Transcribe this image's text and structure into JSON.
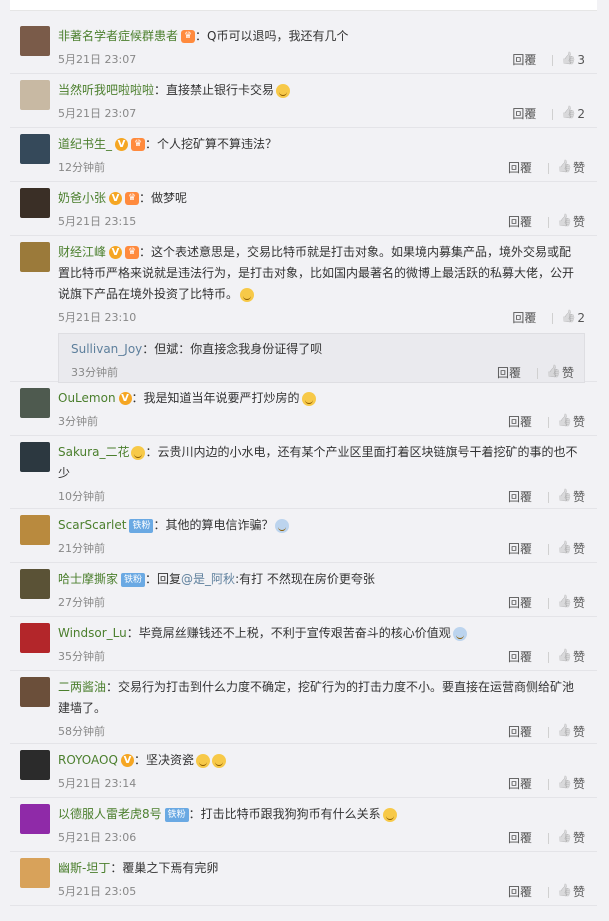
{
  "reply_label": "回覆",
  "comments": [
    {
      "user": "非著名学者症候群患者",
      "text": "：Q币可以退吗，我还有几个",
      "time": "5月21日 23:07",
      "likes": "3",
      "badges": [
        "crown"
      ],
      "avatar_color": "#7a5b49"
    },
    {
      "user": "当然听我吧啦啦啦",
      "text": "：直接禁止银行卡交易",
      "time": "5月21日 23:07",
      "likes": "2",
      "badges": [],
      "emoji": true,
      "avatar_color": "#c8b9a3"
    },
    {
      "user": "道纪书生_",
      "text": "：个人挖矿算不算违法？",
      "time": "12分钟前",
      "likes": "赞",
      "badges": [
        "v",
        "crown"
      ],
      "avatar_color": "#35495a"
    },
    {
      "user": "奶爸小张",
      "text": "：做梦呢",
      "time": "5月21日 23:15",
      "likes": "赞",
      "badges": [
        "v",
        "crown"
      ],
      "avatar_color": "#3a2f26"
    },
    {
      "user": "财经江峰",
      "text_lines": [
        "：这个表述意思是，交易比特币就是打击对象。如果境内募集产品，境外交易或配",
        "置比特币严格来说就是违法行为，是打击对象，比如国内最著名的微博上最活跃的私募大佬，公开",
        "说旗下产品在境外投资了比特币。"
      ],
      "time": "5月21日 23:10",
      "likes": "2",
      "badges": [
        "v",
        "crown"
      ],
      "avatar_color": "#9b7a3a",
      "subreply": {
        "user": "Sullivan_Joy",
        "text": "：但斌：你直接念我身份证得了呗",
        "time": "33分钟前",
        "likes": "赞"
      }
    },
    {
      "user": "OuLemon",
      "text": "：我是知道当年说要严打炒房的",
      "time": "3分钟前",
      "likes": "赞",
      "badges": [
        "v"
      ],
      "emoji": true,
      "avatar_color": "#4e5a4f"
    },
    {
      "user": "Sakura_二花",
      "text_lines": [
        "：云贵川内边的小水电，还有某个产业区里面打着区块链旗号干着挖矿的事的也不",
        "少"
      ],
      "time": "10分钟前",
      "likes": "赞",
      "badges": [],
      "lead_emoji": true,
      "avatar_color": "#2c3840"
    },
    {
      "user": "ScarScarlet",
      "text": "：其他的算电信诈骗？",
      "time": "21分钟前",
      "likes": "赞",
      "badges": [
        "iron"
      ],
      "emoji": true,
      "emoji_type": "cry",
      "avatar_color": "#b98a3e"
    },
    {
      "user": "哈士摩撕家",
      "text": "：回复",
      "mention": "@是_阿秋",
      "text_after": ":有打 不然现在房价更夸张",
      "time": "27分钟前",
      "likes": "赞",
      "badges": [
        "iron"
      ],
      "avatar_color": "#5a5236"
    },
    {
      "user": "Windsor_Lu",
      "text": "：毕竟屌丝赚钱还不上税，不利于宣传艰苦奋斗的核心价值观",
      "time": "35分钟前",
      "likes": "赞",
      "badges": [],
      "emoji": true,
      "emoji_type": "cry",
      "avatar_color": "#b3262a"
    },
    {
      "user": "二两酱油",
      "text_lines": [
        "：交易行为打击到什么力度不确定，挖矿行为的打击力度不小。要直接在运营商侧给矿池",
        "建墙了。"
      ],
      "time": "58分钟前",
      "likes": "赞",
      "badges": [],
      "avatar_color": "#6b4f3a"
    },
    {
      "user": "ROYOAOQ",
      "text": "：坚决资瓷",
      "time": "5月21日 23:14",
      "likes": "赞",
      "badges": [
        "v"
      ],
      "emoji": true,
      "emoji2": true,
      "avatar_color": "#2b2b2b"
    },
    {
      "user": "以德服人雷老虎8号",
      "text": "：打击比特币跟我狗狗币有什么关系",
      "time": "5月21日 23:06",
      "likes": "赞",
      "badges": [
        "iron"
      ],
      "emoji": true,
      "avatar_color": "#8f2aa8"
    },
    {
      "user": "幽斯-坦丁",
      "text": "：覆巢之下焉有完卵",
      "time": "5月21日 23:05",
      "likes": "赞",
      "badges": [],
      "avatar_color": "#d8a25a"
    }
  ]
}
